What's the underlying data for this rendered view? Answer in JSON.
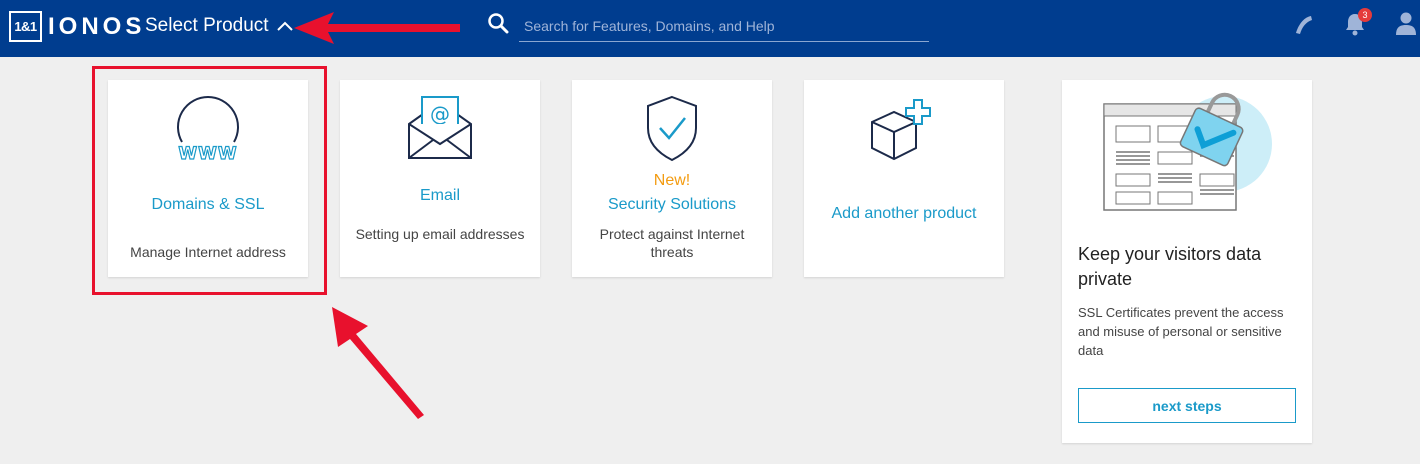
{
  "header": {
    "logo_box": "1&1",
    "logo_text": "IONOS",
    "select_product_label": "Select Product",
    "search_placeholder": "Search for Features, Domains, and Help",
    "notification_count": "3"
  },
  "products": [
    {
      "title": "Domains & SSL",
      "description": "Manage Internet address",
      "icon": "globe-www-icon"
    },
    {
      "title": "Email",
      "description": "Setting up email addresses",
      "icon": "envelope-at-icon"
    },
    {
      "new_label": "New!",
      "title": "Security Solutions",
      "description": "Protect against Internet threats",
      "icon": "shield-check-icon"
    },
    {
      "title": "Add another product",
      "icon": "box-plus-icon"
    }
  ],
  "promo": {
    "title": "Keep your visitors data private",
    "text": "SSL Certificates prevent the access and misuse of personal or sensitive data",
    "button_label": "next steps"
  },
  "colors": {
    "header_bg": "#003d8f",
    "accent": "#1a9ac9",
    "new_label": "#f39c12",
    "annotation_red": "#e8112d"
  }
}
